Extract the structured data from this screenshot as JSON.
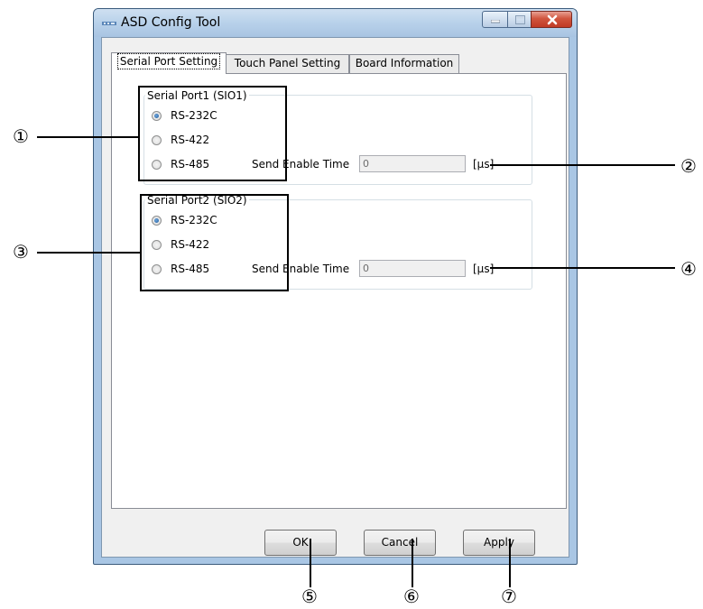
{
  "window": {
    "title": "ASD Config Tool"
  },
  "tabs": [
    "Serial Port Setting",
    "Touch Panel Setting",
    "Board Information"
  ],
  "port1": {
    "legend": "Serial Port1 (SIO1)",
    "options": [
      "RS-232C",
      "RS-422",
      "RS-485"
    ],
    "selected": "RS-232C",
    "send_label": "Send Enable Time",
    "send_value": "0",
    "unit": "[μs]"
  },
  "port2": {
    "legend": "Serial Port2 (SIO2)",
    "options": [
      "RS-232C",
      "RS-422",
      "RS-485"
    ],
    "selected": "RS-232C",
    "send_label": "Send Enable Time",
    "send_value": "0",
    "unit": "[μs]"
  },
  "buttons": {
    "ok": "OK",
    "cancel": "Cancel",
    "apply": "Apply"
  },
  "markers": [
    "①",
    "②",
    "③",
    "④",
    "⑤",
    "⑥",
    "⑦"
  ]
}
